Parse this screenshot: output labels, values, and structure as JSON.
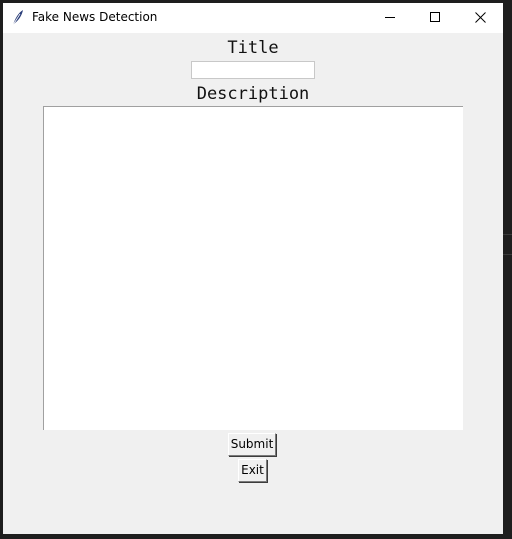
{
  "window": {
    "title": "Fake News Detection"
  },
  "form": {
    "title_label": "Title",
    "title_value": "",
    "description_label": "Description",
    "description_value": ""
  },
  "buttons": {
    "submit_label": "Submit",
    "exit_label": "Exit"
  }
}
